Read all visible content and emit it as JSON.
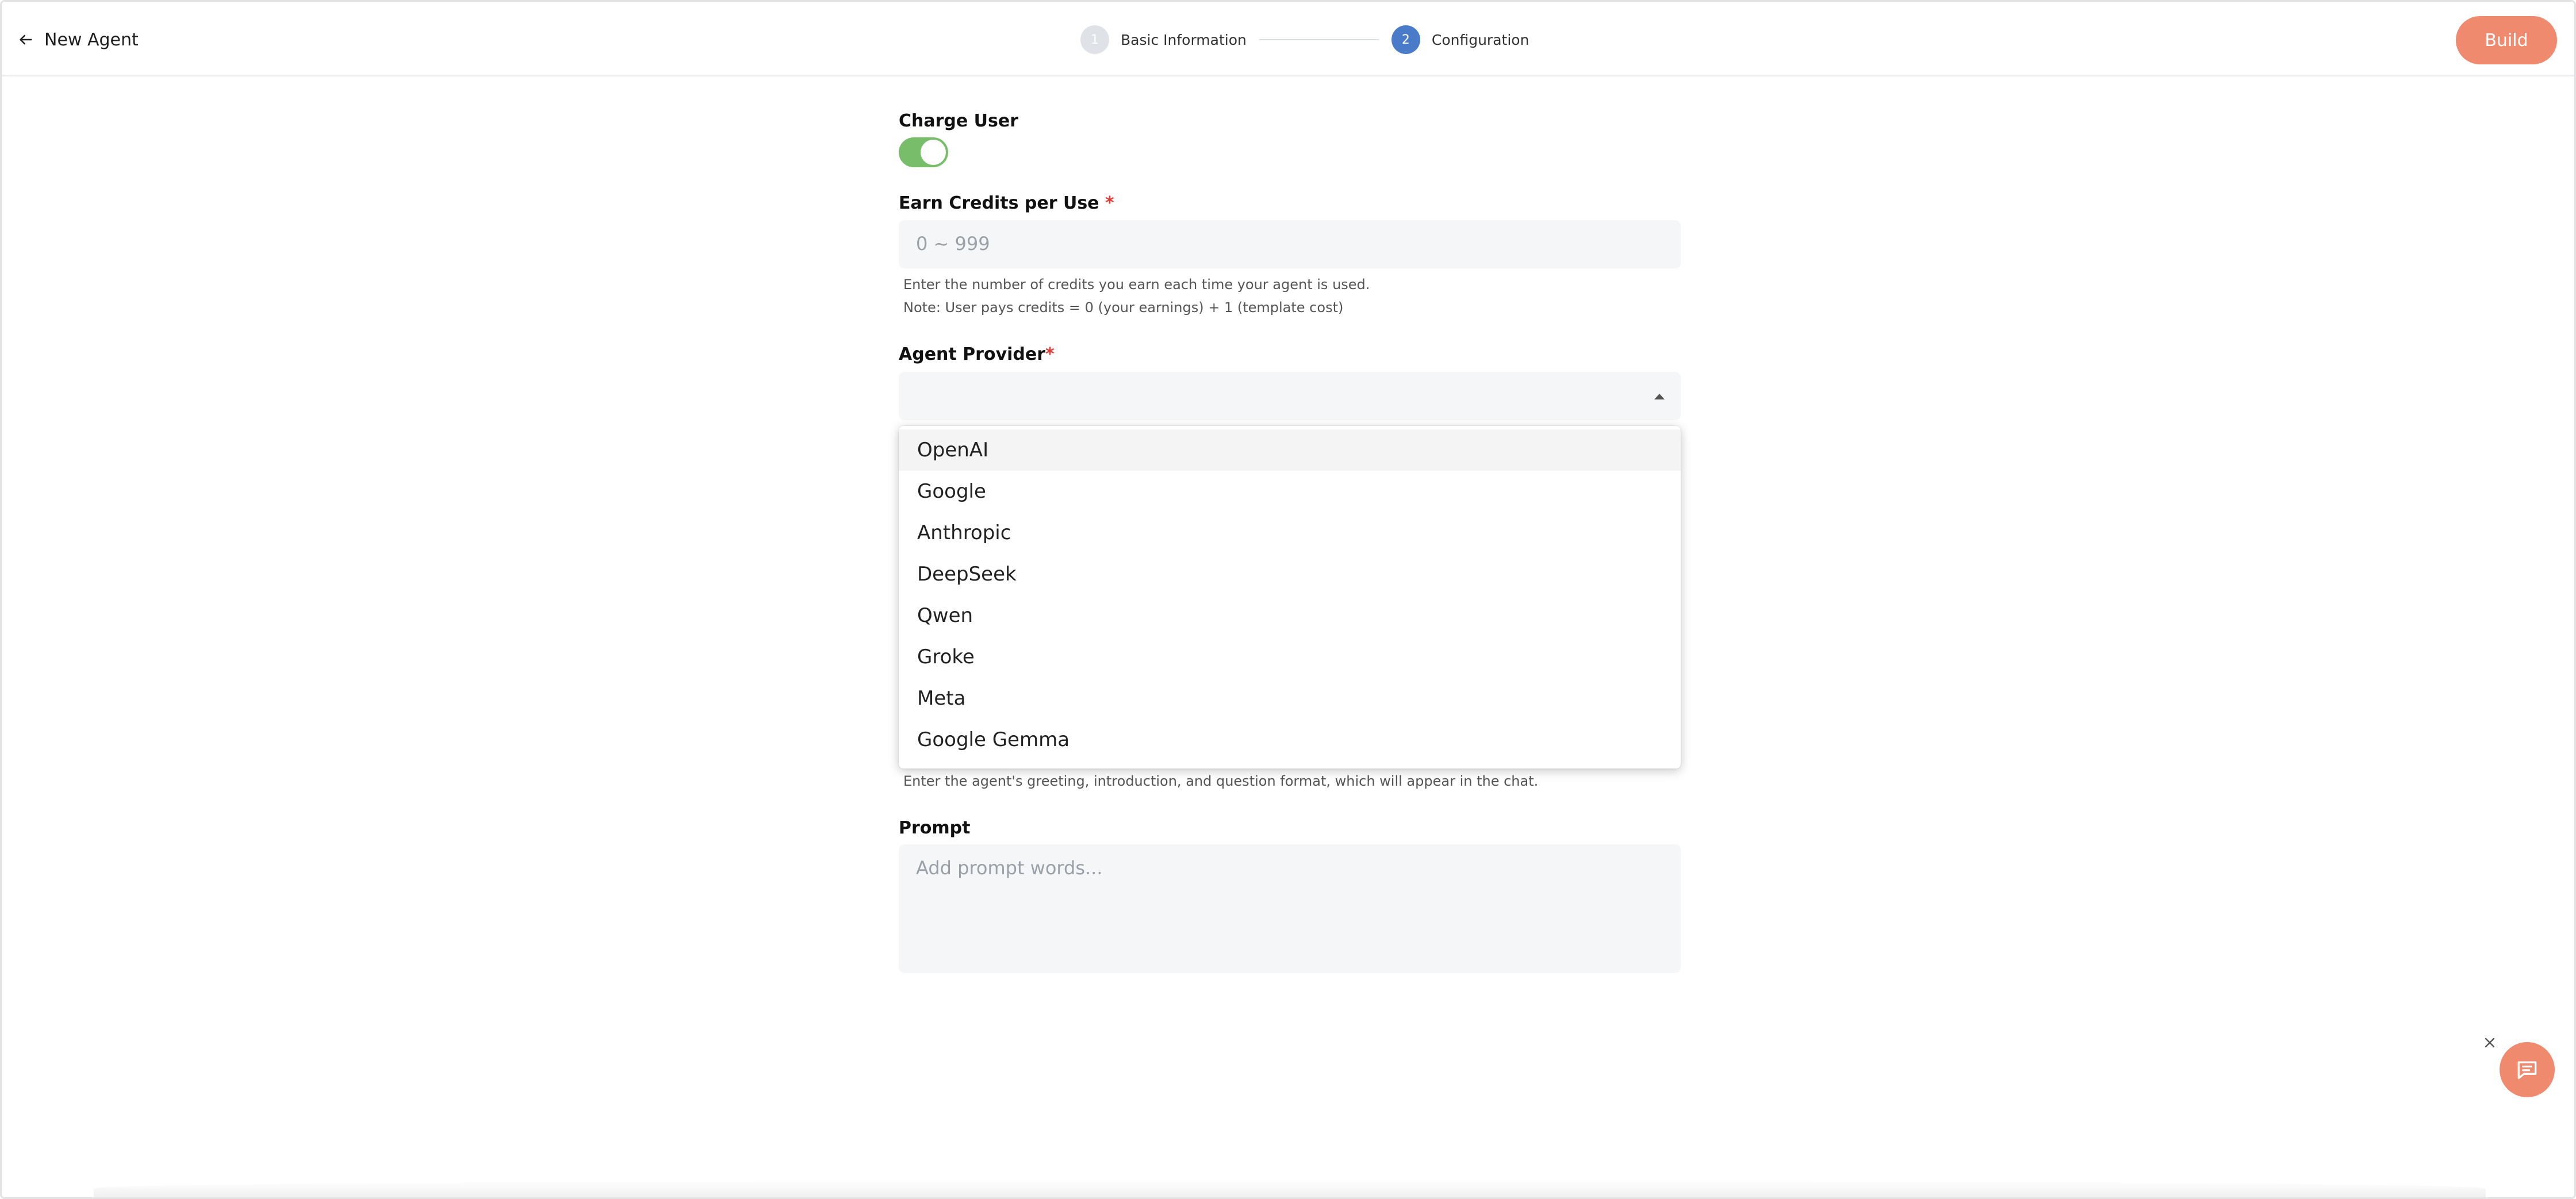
{
  "header": {
    "back_label": "New Agent",
    "build_label": "Build",
    "steps": [
      {
        "number": "1",
        "label": "Basic Information"
      },
      {
        "number": "2",
        "label": "Configuration"
      }
    ]
  },
  "form": {
    "charge_user": {
      "label": "Charge User",
      "enabled": true
    },
    "earn_credits": {
      "label": "Earn Credits per Use",
      "required_mark": "*",
      "placeholder": "0 ~ 999",
      "help_1": "Enter the number of credits you earn each time your agent is used.",
      "help_2": "Note: User pays credits = 0 (your earnings) + 1 (template cost)"
    },
    "agent_provider": {
      "label": "Agent Provider",
      "required_mark": "*",
      "value": "",
      "options": [
        "OpenAI",
        "Google",
        "Anthropic",
        "DeepSeek",
        "Qwen",
        "Groke",
        "Meta",
        "Google Gemma"
      ]
    },
    "greeting_help": "Enter the agent's greeting, introduction, and question format, which will appear in the chat.",
    "prompt": {
      "label": "Prompt",
      "placeholder": "Add prompt words..."
    }
  },
  "colors": {
    "accent": "#ef8a6e",
    "step_active": "#4a7bc8",
    "toggle_on": "#78bd6a",
    "required": "#e53935"
  }
}
